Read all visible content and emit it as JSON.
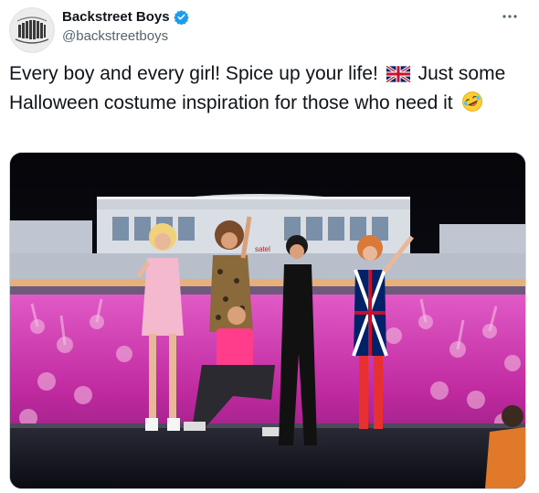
{
  "author": {
    "display_name": "Backstreet Boys",
    "handle": "@backstreetboys",
    "verified": true,
    "avatar_icon": "band-logo-avatar"
  },
  "tweet": {
    "text_part1": "Every boy and every girl! Spice up your life!",
    "flag_emoji": "uk-flag-icon",
    "text_part2": "Just some Halloween costume inspiration for those who need it",
    "end_emoji": "rolling-on-floor-laughing-icon"
  },
  "more_menu_icon": "more-options-icon",
  "media": {
    "description_icon": "photo",
    "stage_sign_text": "satel"
  },
  "colors": {
    "verified_blue": "#1d9bf0",
    "secondary_text": "#536471",
    "crowd_pink": "#c02aa0"
  }
}
